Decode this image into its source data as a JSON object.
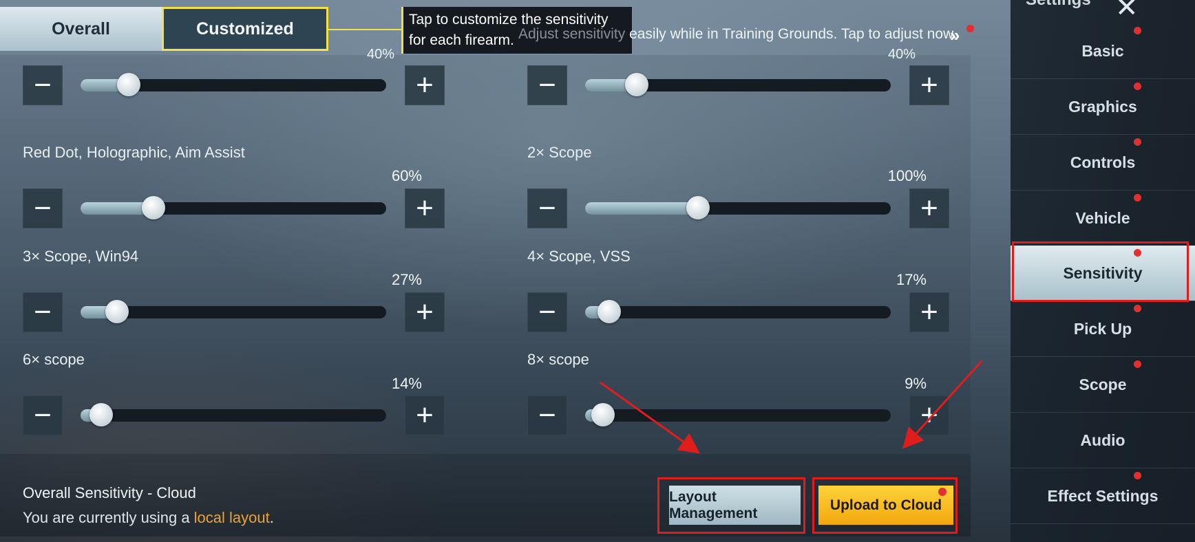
{
  "tabs": {
    "overall": "Overall",
    "customized": "Customized"
  },
  "tooltip": "Tap to customize the sensitivity for each firearm.",
  "notice": {
    "dim": "Adjust sensitivity ",
    "text": "easily while in Training Grounds. Tap to adjust now.",
    "arrow": "»"
  },
  "top_row": {
    "left_pct": "40%",
    "right_pct": "40%",
    "left_value": 12,
    "right_value": 13
  },
  "rows": [
    {
      "label": "Red Dot, Holographic, Aim Assist",
      "pct": "60%",
      "value": 20
    },
    {
      "label": "2× Scope",
      "pct": "100%",
      "value": 33
    },
    {
      "label": "3× Scope, Win94",
      "pct": "27%",
      "value": 8
    },
    {
      "label": "4× Scope, VSS",
      "pct": "17%",
      "value": 4
    },
    {
      "label": "6× scope",
      "pct": "14%",
      "value": 3
    },
    {
      "label": "8× scope",
      "pct": "9%",
      "value": 2
    }
  ],
  "controls": {
    "minus": "−",
    "plus": "+"
  },
  "cloud": {
    "title": "Overall Sensitivity - Cloud",
    "desc_prefix": "You are currently using a ",
    "desc_link": "local layout",
    "desc_suffix": "."
  },
  "buttons": {
    "layout": "Layout Management",
    "upload": "Upload to Cloud"
  },
  "sidebar": {
    "header": "Settings",
    "items": [
      {
        "label": "Basic"
      },
      {
        "label": "Graphics"
      },
      {
        "label": "Controls"
      },
      {
        "label": "Vehicle"
      },
      {
        "label": "Sensitivity"
      },
      {
        "label": "Pick Up"
      },
      {
        "label": "Scope"
      },
      {
        "label": "Audio"
      },
      {
        "label": "Effect Settings"
      }
    ],
    "active": "Sensitivity"
  },
  "colors": {
    "accent_yellow": "#f4e04a",
    "highlight_red": "#e01d1d",
    "notify_red": "#e03030",
    "upload_orange": "#f2a90e"
  },
  "icons": {
    "close": "close-icon",
    "notice_arrow": "double-chevron-icon"
  }
}
